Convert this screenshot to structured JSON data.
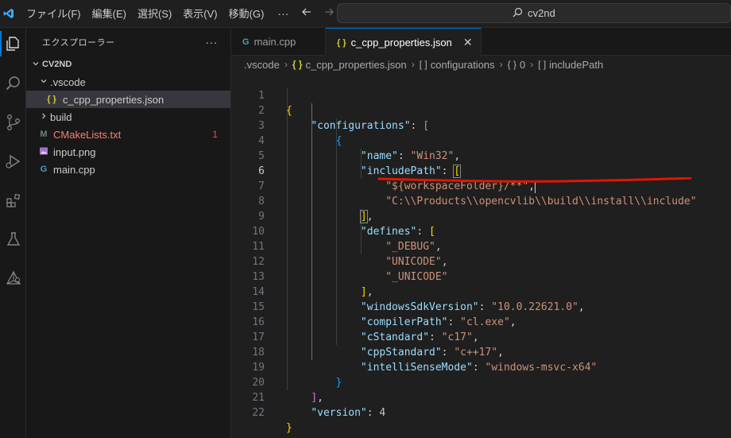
{
  "titlebar": {
    "menu": [
      "ファイル(F)",
      "編集(E)",
      "選択(S)",
      "表示(V)",
      "移動(G)"
    ],
    "more": "···",
    "search_text": "cv2nd"
  },
  "sidebar": {
    "title": "エクスプローラー",
    "more": "···",
    "root": "CV2ND",
    "items": [
      {
        "label": ".vscode",
        "icon": "chevron-down-icon"
      },
      {
        "label": "c_cpp_properties.json",
        "icon": "json-file-icon",
        "glyph": "{ }"
      },
      {
        "label": "build",
        "icon": "chevron-right-icon"
      },
      {
        "label": "CMakeLists.txt",
        "icon": "cmake-file-icon",
        "glyph": "M",
        "badge": "1"
      },
      {
        "label": "input.png",
        "icon": "image-file-icon"
      },
      {
        "label": "main.cpp",
        "icon": "cpp-file-icon",
        "glyph": "G"
      }
    ]
  },
  "tabs": [
    {
      "label": "main.cpp",
      "glyph": "G",
      "active": false
    },
    {
      "label": "c_cpp_properties.json",
      "glyph": "{ }",
      "active": true,
      "close": "✕"
    }
  ],
  "breadcrumb": {
    "folder": ".vscode",
    "file": "c_cpp_properties.json",
    "configurations": "configurations",
    "index": "0",
    "includePath": "includePath",
    "sep": "›"
  },
  "editor": {
    "line_numbers": [
      "1",
      "2",
      "3",
      "4",
      "5",
      "6",
      "7",
      "8",
      "9",
      "10",
      "11",
      "12",
      "13",
      "14",
      "15",
      "16",
      "17",
      "18",
      "19",
      "20",
      "21",
      "22"
    ],
    "current_line": "6",
    "t": {
      "open_brace": "{",
      "close_brace": "}",
      "open_bracket": "[",
      "close_bracket": "]",
      "close_bracket_comma": "],",
      "close_brace_comma": "},",
      "colon": ": ",
      "comma": ",",
      "k_configurations": "\"configurations\"",
      "k_name": "\"name\"",
      "v_name": "\"Win32\"",
      "k_includePath": "\"includePath\"",
      "v_inc1": "\"${workspaceFolder}/**\"",
      "v_inc2": "\"C:\\\\Products\\\\opencvlib\\\\build\\\\install\\\\include\"",
      "k_defines": "\"defines\"",
      "v_def1": "\"_DEBUG\"",
      "v_def2": "\"UNICODE\"",
      "v_def3": "\"_UNICODE\"",
      "k_sdk": "\"windowsSdkVersion\"",
      "v_sdk": "\"10.0.22621.0\"",
      "k_compiler": "\"compilerPath\"",
      "v_compiler": "\"cl.exe\"",
      "k_cstd": "\"cStandard\"",
      "v_cstd": "\"c17\"",
      "k_cppstd": "\"cppStandard\"",
      "v_cppstd": "\"c++17\"",
      "k_intelli": "\"intelliSenseMode\"",
      "v_intelli": "\"windows-msvc-x64\"",
      "k_version": "\"version\"",
      "v_version": "4"
    }
  },
  "colors": {
    "accent": "#0078d4",
    "annotation": "#e51400"
  }
}
